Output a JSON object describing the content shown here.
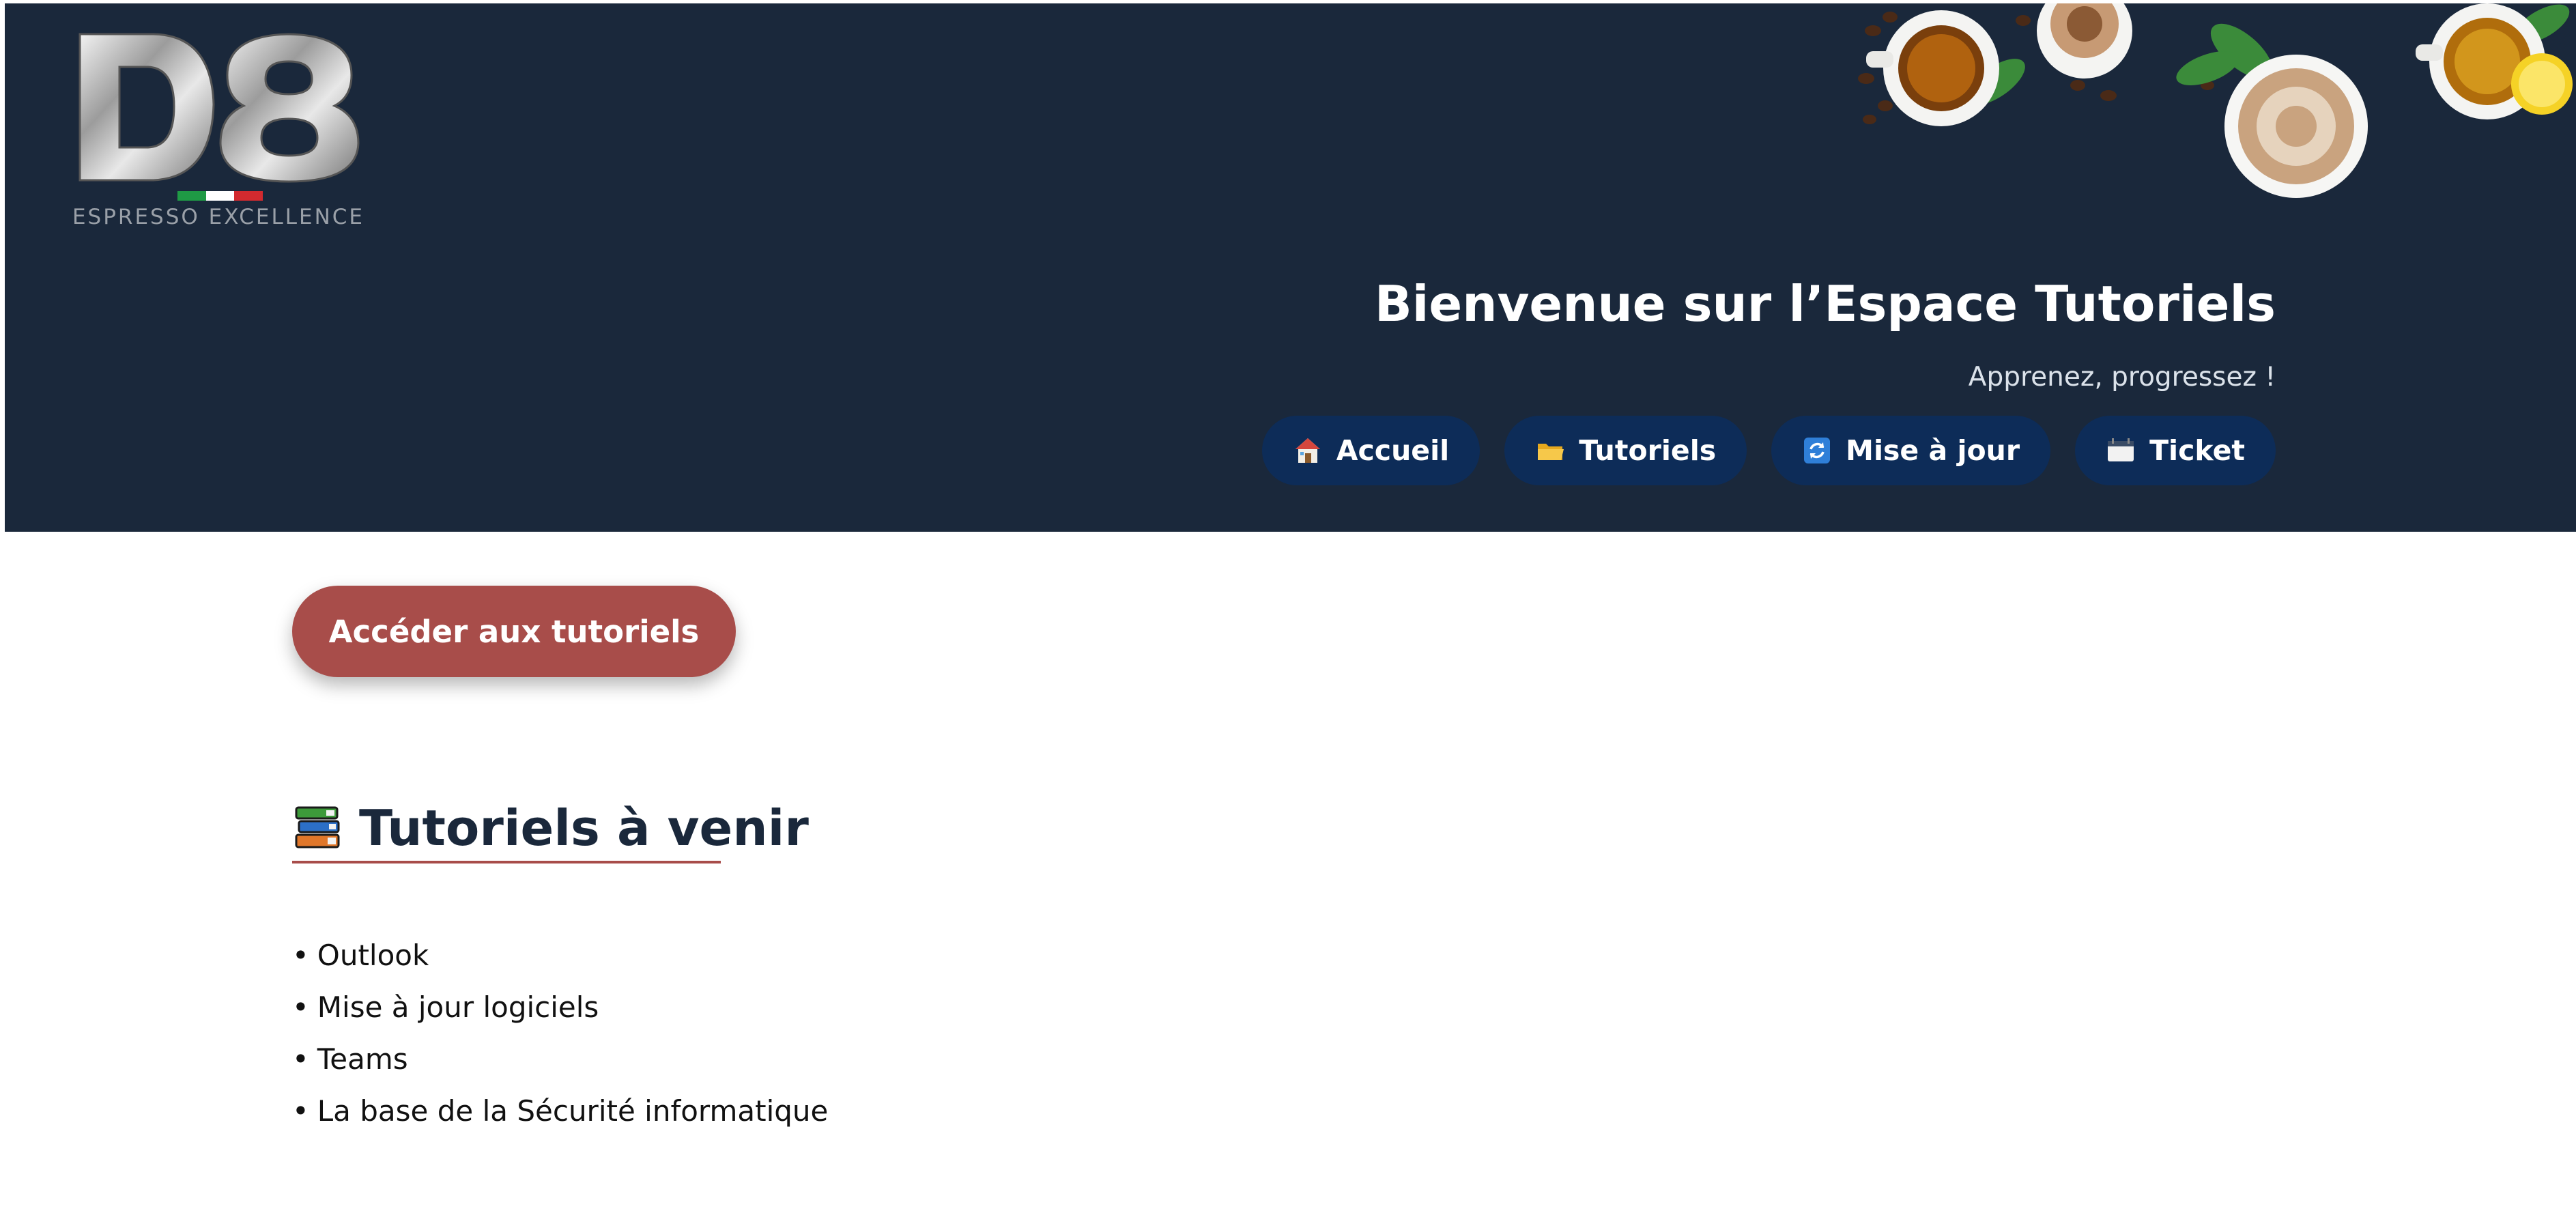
{
  "header": {
    "logo": {
      "mark": "D8",
      "tagline": "ESPRESSO EXCELLENCE",
      "flag_colors": [
        "#1f9a45",
        "#ffffff",
        "#d22a2f"
      ]
    },
    "title": "Bienvenue sur l’Espace Tutoriels",
    "subtitle": "Apprenez, progressez !",
    "nav": [
      {
        "label": "Accueil",
        "icon": "house-icon"
      },
      {
        "label": "Tutoriels",
        "icon": "folder-icon"
      },
      {
        "label": "Mise à jour",
        "icon": "refresh-icon"
      },
      {
        "label": "Ticket",
        "icon": "ticket-icon"
      }
    ]
  },
  "cta": {
    "label": "Accéder aux tutoriels"
  },
  "upcoming": {
    "icon": "books-icon",
    "title": "Tutoriels à venir",
    "items": [
      "Outlook",
      "Mise à jour logiciels",
      "Teams",
      "La base de la Sécurité informatique"
    ]
  },
  "colors": {
    "header_bg": "#1a283b",
    "nav_button_bg": "#0d2c58",
    "accent": "#a84d4a"
  }
}
